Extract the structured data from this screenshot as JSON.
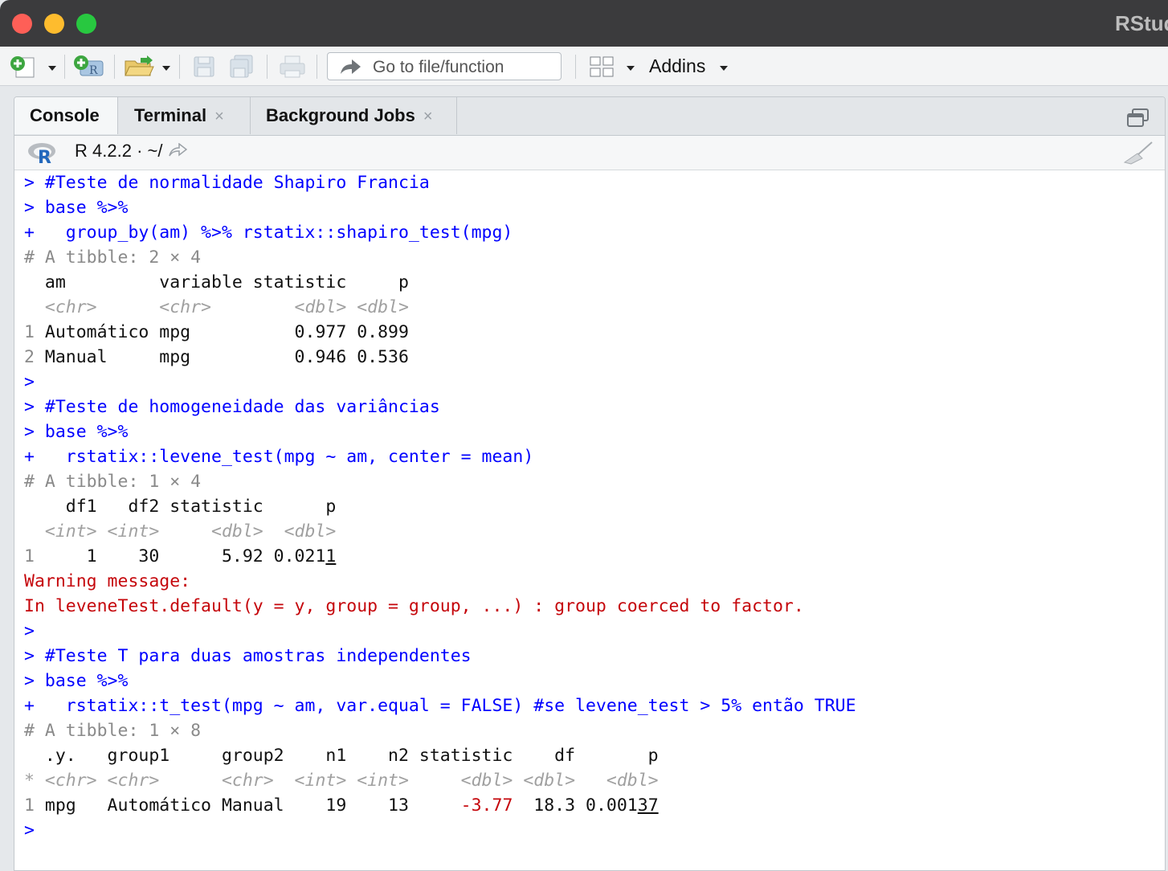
{
  "window": {
    "title": "RStudio"
  },
  "toolbar": {
    "goto_placeholder": "Go to file/function",
    "addins_label": "Addins"
  },
  "tabs": [
    {
      "label": "Console",
      "active": true
    },
    {
      "label": "Terminal",
      "closable": true
    },
    {
      "label": "Background Jobs",
      "closable": true
    }
  ],
  "console_header": {
    "r_version": "R 4.2.2",
    "separator": "·",
    "path": "~/"
  },
  "console": {
    "l1": "> #Teste de normalidade Shapiro Francia",
    "l2": "> base %>%",
    "l3": "+   group_by(am) %>% rstatix::shapiro_test(mpg)",
    "l4": "# A tibble: 2 × 4",
    "l5": "  am         variable statistic     p",
    "l6": "  <chr>      <chr>        <dbl> <dbl>",
    "l7_num": "1",
    "l7": " Automático mpg          0.977 0.899",
    "l8_num": "2",
    "l8": " Manual     mpg          0.946 0.536",
    "l9": ">",
    "l10": "> #Teste de homogeneidade das variâncias",
    "l11": "> base %>%",
    "l12": "+   rstatix::levene_test(mpg ~ am, center = mean)",
    "l13": "# A tibble: 1 × 4",
    "l14": "    df1   df2 statistic      p",
    "l15": "  <int> <int>     <dbl>  <dbl>",
    "l16_num": "1",
    "l16a": "     1    30      5.92 0.021",
    "l16b": "1",
    "l17": "Warning message:",
    "l18": "In leveneTest.default(y = y, group = group, ...) : group coerced to factor.",
    "l19": ">",
    "l20": "> #Teste T para duas amostras independentes",
    "l21": "> base %>%",
    "l22": "+   rstatix::t_test(mpg ~ am, var.equal = FALSE) #se levene_test > 5% então TRUE",
    "l23": "# A tibble: 1 × 8",
    "l24": "  .y.   group1     group2    n1    n2 statistic    df       p",
    "l25_num": "*",
    "l25": " <chr> <chr>      <chr>  <int> <int>     <dbl> <dbl>   <dbl>",
    "l26_num": "1",
    "l26a": " mpg   Automático Manual    19    13     ",
    "l26b": "-3.77",
    "l26c": "  18.3 0.001",
    "l26d": "37",
    "l27": ">"
  }
}
